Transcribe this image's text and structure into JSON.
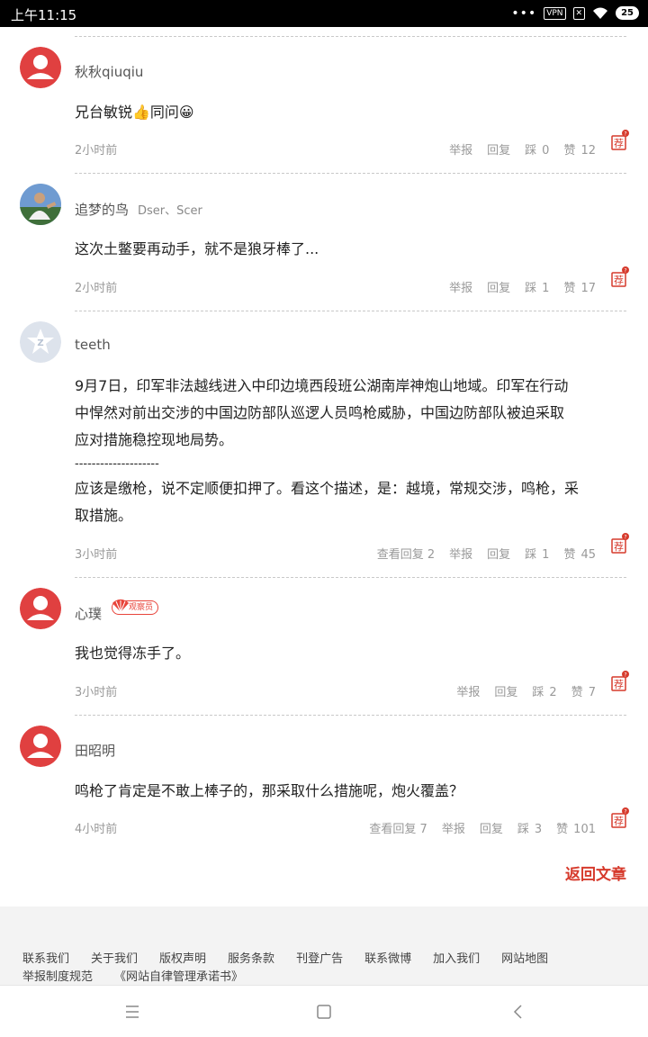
{
  "status_bar": {
    "time": "上午11:15",
    "vpn": "VPN",
    "battery": "25"
  },
  "comments": [
    {
      "user": "秋秋qiuqiu",
      "tag": "",
      "badge": "",
      "text_lines": [
        "兄台敏锐👍同问😀"
      ],
      "time": "2小时前",
      "view_replies": "",
      "report": "举报",
      "reply": "回复",
      "dislike_label": "踩",
      "dislike_count": "0",
      "like_label": "赞",
      "like_count": "12",
      "recommend": "荐"
    },
    {
      "user": "追梦的鸟",
      "tag": "Dser、Scer",
      "badge": "",
      "text_lines": [
        "这次土鳖要再动手，就不是狼牙棒了..."
      ],
      "time": "2小时前",
      "view_replies": "",
      "report": "举报",
      "reply": "回复",
      "dislike_label": "踩",
      "dislike_count": "1",
      "like_label": "赞",
      "like_count": "17",
      "recommend": "荐"
    },
    {
      "user": "teeth",
      "tag": "",
      "badge": "",
      "text_lines": [
        "9月7日，印军非法越线进入中印边境西段班公湖南岸神炮山地域。印军在行动",
        "中悍然对前出交涉的中国边防部队巡逻人员鸣枪威胁，中国边防部队被迫采取",
        "应对措施稳控现地局势。",
        "--------------------",
        "应该是缴枪，说不定顺便扣押了。看这个描述，是：越境，常规交涉，鸣枪，采",
        "取措施。"
      ],
      "time": "3小时前",
      "view_replies": "查看回复 2",
      "report": "举报",
      "reply": "回复",
      "dislike_label": "踩",
      "dislike_count": "1",
      "like_label": "赞",
      "like_count": "45",
      "recommend": "荐"
    },
    {
      "user": "心璞",
      "tag": "",
      "badge": "观察员",
      "text_lines": [
        "我也觉得冻手了。"
      ],
      "time": "3小时前",
      "view_replies": "",
      "report": "举报",
      "reply": "回复",
      "dislike_label": "踩",
      "dislike_count": "2",
      "like_label": "赞",
      "like_count": "7",
      "recommend": "荐"
    },
    {
      "user": "田昭明",
      "tag": "",
      "badge": "",
      "text_lines": [
        "鸣枪了肯定是不敢上棒子的，那采取什么措施呢，炮火覆盖？"
      ],
      "time": "4小时前",
      "view_replies": "查看回复 7",
      "report": "举报",
      "reply": "回复",
      "dislike_label": "踩",
      "dislike_count": "3",
      "like_label": "赞",
      "like_count": "101",
      "recommend": "荐"
    }
  ],
  "back_to_article": "返回文章",
  "footer_links": [
    "联系我们",
    "关于我们",
    "版权声明",
    "服务条款",
    "刊登广告",
    "联系微博",
    "加入我们",
    "网站地图",
    "举报制度规范",
    "《网站自律管理承诺书》"
  ],
  "colors": {
    "accent": "#d63a2c",
    "avatar_red": "#e04040",
    "text_muted": "#999999"
  },
  "icons": {
    "menu": "menu-icon",
    "home": "square-home-icon",
    "back": "chevron-left-icon"
  }
}
